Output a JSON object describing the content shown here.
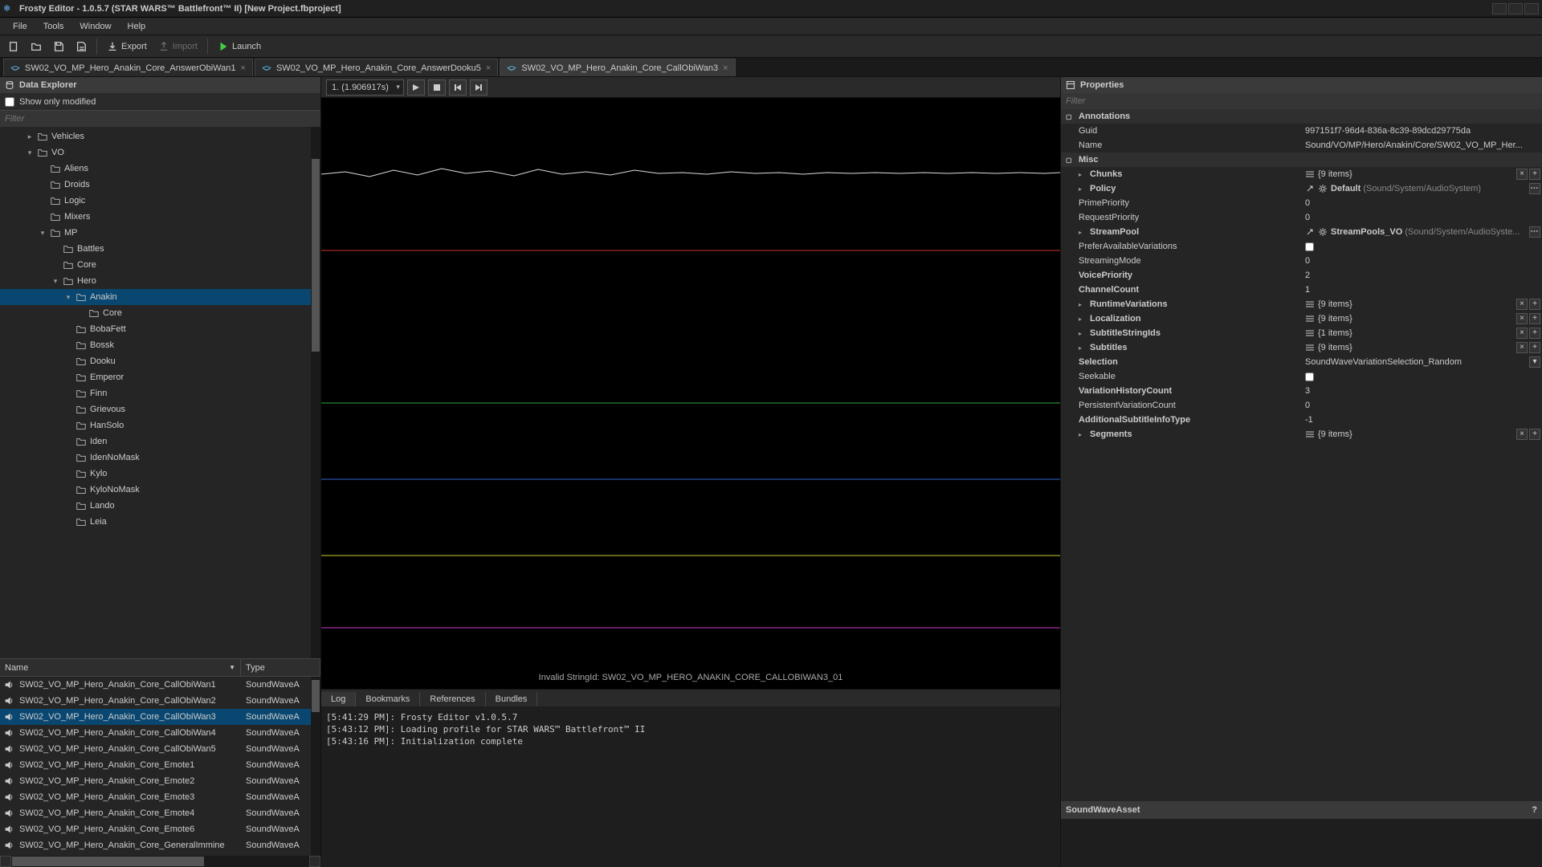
{
  "title": "Frosty Editor - 1.0.5.7 (STAR WARS™ Battlefront™ II) [New Project.fbproject]",
  "menu": [
    "File",
    "Tools",
    "Window",
    "Help"
  ],
  "toolbar": {
    "export": "Export",
    "import": "Import",
    "launch": "Launch"
  },
  "tabs": [
    {
      "label": "SW02_VO_MP_Hero_Anakin_Core_AnswerObiWan1",
      "active": false
    },
    {
      "label": "SW02_VO_MP_Hero_Anakin_Core_AnswerDooku5",
      "active": false
    },
    {
      "label": "SW02_VO_MP_Hero_Anakin_Core_CallObiWan3",
      "active": true
    }
  ],
  "dataExplorer": {
    "title": "Data Explorer",
    "showOnly": "Show only modified",
    "filter": "Filter",
    "tree": [
      {
        "d": 2,
        "arrow": "▸",
        "label": "Vehicles"
      },
      {
        "d": 2,
        "arrow": "▾",
        "label": "VO"
      },
      {
        "d": 3,
        "arrow": "",
        "label": "Aliens"
      },
      {
        "d": 3,
        "arrow": "",
        "label": "Droids"
      },
      {
        "d": 3,
        "arrow": "",
        "label": "Logic"
      },
      {
        "d": 3,
        "arrow": "",
        "label": "Mixers"
      },
      {
        "d": 3,
        "arrow": "▾",
        "label": "MP"
      },
      {
        "d": 4,
        "arrow": "",
        "label": "Battles"
      },
      {
        "d": 4,
        "arrow": "",
        "label": "Core"
      },
      {
        "d": 4,
        "arrow": "▾",
        "label": "Hero"
      },
      {
        "d": 5,
        "arrow": "▾",
        "label": "Anakin",
        "sel": true
      },
      {
        "d": 6,
        "arrow": "",
        "label": "Core"
      },
      {
        "d": 5,
        "arrow": "",
        "label": "BobaFett"
      },
      {
        "d": 5,
        "arrow": "",
        "label": "Bossk"
      },
      {
        "d": 5,
        "arrow": "",
        "label": "Dooku"
      },
      {
        "d": 5,
        "arrow": "",
        "label": "Emperor"
      },
      {
        "d": 5,
        "arrow": "",
        "label": "Finn"
      },
      {
        "d": 5,
        "arrow": "",
        "label": "Grievous"
      },
      {
        "d": 5,
        "arrow": "",
        "label": "HanSolo"
      },
      {
        "d": 5,
        "arrow": "",
        "label": "Iden"
      },
      {
        "d": 5,
        "arrow": "",
        "label": "IdenNoMask"
      },
      {
        "d": 5,
        "arrow": "",
        "label": "Kylo"
      },
      {
        "d": 5,
        "arrow": "",
        "label": "KyloNoMask"
      },
      {
        "d": 5,
        "arrow": "",
        "label": "Lando"
      },
      {
        "d": 5,
        "arrow": "",
        "label": "Leia"
      }
    ]
  },
  "assetList": {
    "cols": [
      "Name",
      "Type"
    ],
    "rows": [
      {
        "n": "SW02_VO_MP_Hero_Anakin_Core_CallObiWan1",
        "t": "SoundWaveA"
      },
      {
        "n": "SW02_VO_MP_Hero_Anakin_Core_CallObiWan2",
        "t": "SoundWaveA"
      },
      {
        "n": "SW02_VO_MP_Hero_Anakin_Core_CallObiWan3",
        "t": "SoundWaveA",
        "sel": true
      },
      {
        "n": "SW02_VO_MP_Hero_Anakin_Core_CallObiWan4",
        "t": "SoundWaveA"
      },
      {
        "n": "SW02_VO_MP_Hero_Anakin_Core_CallObiWan5",
        "t": "SoundWaveA"
      },
      {
        "n": "SW02_VO_MP_Hero_Anakin_Core_Emote1",
        "t": "SoundWaveA"
      },
      {
        "n": "SW02_VO_MP_Hero_Anakin_Core_Emote2",
        "t": "SoundWaveA"
      },
      {
        "n": "SW02_VO_MP_Hero_Anakin_Core_Emote3",
        "t": "SoundWaveA"
      },
      {
        "n": "SW02_VO_MP_Hero_Anakin_Core_Emote4",
        "t": "SoundWaveA"
      },
      {
        "n": "SW02_VO_MP_Hero_Anakin_Core_Emote6",
        "t": "SoundWaveA"
      },
      {
        "n": "SW02_VO_MP_Hero_Anakin_Core_GeneralImmine",
        "t": "SoundWaveA"
      }
    ]
  },
  "wave": {
    "combo": "1. (1.906917s)",
    "stringId": "Invalid StringId: SW02_VO_MP_HERO_ANAKIN_CORE_CALLOBIWAN3_01"
  },
  "bottomTabs": [
    "Log",
    "Bookmarks",
    "References",
    "Bundles"
  ],
  "log": "[5:41:29 PM]: Frosty Editor v1.0.5.7\n[5:43:12 PM]: Loading profile for STAR WARS™ Battlefront™ II\n[5:43:16 PM]: Initialization complete",
  "properties": {
    "title": "Properties",
    "filter": "Filter",
    "sections": [
      {
        "name": "Annotations",
        "rows": [
          {
            "k": "Guid",
            "v": "997151f7-96d4-836a-8c39-89dcd29775da"
          },
          {
            "k": "Name",
            "v": "Sound/VO/MP/Hero/Anakin/Core/SW02_VO_MP_Her..."
          }
        ]
      },
      {
        "name": "Misc",
        "rows": [
          {
            "k": "Chunks",
            "type": "list",
            "v": "{9 items}",
            "btns": [
              "×",
              "+"
            ]
          },
          {
            "k": "Policy",
            "type": "ref",
            "v": "Default",
            "path": "(Sound/System/AudioSystem)",
            "btns": [
              "…"
            ]
          },
          {
            "k": "PrimePriority",
            "v": "0"
          },
          {
            "k": "RequestPriority",
            "v": "0"
          },
          {
            "k": "StreamPool",
            "type": "ref",
            "v": "StreamPools_VO",
            "path": "(Sound/System/AudioSyste...",
            "btns": [
              "…"
            ]
          },
          {
            "k": "PreferAvailableVariations",
            "type": "check",
            "v": false
          },
          {
            "k": "StreamingMode",
            "v": "0"
          },
          {
            "k": "VoicePriority",
            "v": "2"
          },
          {
            "k": "ChannelCount",
            "v": "1"
          },
          {
            "k": "RuntimeVariations",
            "type": "list",
            "v": "{9 items}",
            "btns": [
              "×",
              "+"
            ]
          },
          {
            "k": "Localization",
            "type": "list",
            "v": "{9 items}",
            "btns": [
              "×",
              "+"
            ]
          },
          {
            "k": "SubtitleStringIds",
            "type": "list",
            "v": "{1 items}",
            "btns": [
              "×",
              "+"
            ]
          },
          {
            "k": "Subtitles",
            "type": "list",
            "v": "{9 items}",
            "btns": [
              "×",
              "+"
            ]
          },
          {
            "k": "Selection",
            "v": "SoundWaveVariationSelection_Random",
            "type": "dropdown"
          },
          {
            "k": "Seekable",
            "type": "check",
            "v": false
          },
          {
            "k": "VariationHistoryCount",
            "v": "3"
          },
          {
            "k": "PersistentVariationCount",
            "v": "0"
          },
          {
            "k": "AdditionalSubtitleInfoType",
            "v": "-1"
          },
          {
            "k": "Segments",
            "type": "list",
            "v": "{9 items}",
            "btns": [
              "×",
              "+"
            ]
          }
        ]
      }
    ],
    "assetType": "SoundWaveAsset"
  }
}
